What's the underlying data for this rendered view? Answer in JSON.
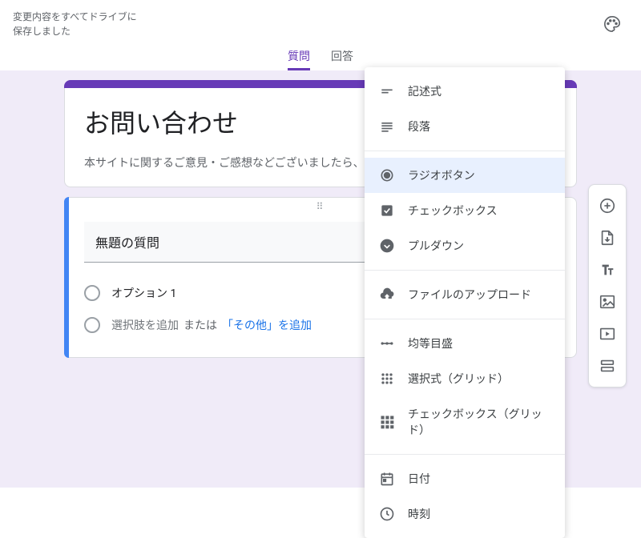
{
  "header": {
    "save_status_line1": "変更内容をすべてドライブに",
    "save_status_line2": "保存しました"
  },
  "tabs": {
    "questions": "質問",
    "responses": "回答"
  },
  "form": {
    "title": "お問い合わせ",
    "description": "本サイトに関するご意見・ご感想などございましたら、お気軽にお"
  },
  "question": {
    "title": "無題の質問",
    "option1": "オプション 1",
    "add_option": "選択肢を追加",
    "or_text": " または ",
    "add_other": "「その他」を追加"
  },
  "type_menu": [
    {
      "icon": "short-text",
      "label": "記述式"
    },
    {
      "icon": "paragraph",
      "label": "段落"
    },
    {
      "divider": true
    },
    {
      "icon": "radio",
      "label": "ラジオボタン",
      "selected": true
    },
    {
      "icon": "checkbox",
      "label": "チェックボックス"
    },
    {
      "icon": "dropdown",
      "label": "プルダウン"
    },
    {
      "divider": true
    },
    {
      "icon": "upload",
      "label": "ファイルのアップロード"
    },
    {
      "divider": true
    },
    {
      "icon": "linear",
      "label": "均等目盛"
    },
    {
      "icon": "grid-mc",
      "label": "選択式（グリッド）"
    },
    {
      "icon": "grid-cb",
      "label": "チェックボックス（グリッド）"
    },
    {
      "divider": true
    },
    {
      "icon": "date",
      "label": "日付"
    },
    {
      "icon": "time",
      "label": "時刻"
    }
  ]
}
